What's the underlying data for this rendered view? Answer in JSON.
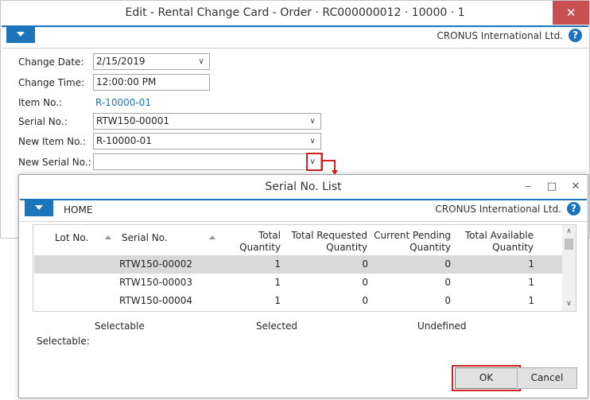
{
  "main_window": {
    "title": "Edit - Rental Change Card - Order · RC000000012 · 10000 · 1",
    "company": "CRONUS International Ltd.",
    "fields": {
      "change_date_label": "Change Date:",
      "change_date_value": "2/15/2019",
      "change_time_label": "Change Time:",
      "change_time_value": "12:00:00 PM",
      "item_no_label": "Item No.:",
      "item_no_value": "R-10000-01",
      "serial_no_label": "Serial No.:",
      "serial_no_value": "RTW150-00001",
      "new_item_no_label": "New Item No.:",
      "new_item_no_value": "R-10000-01",
      "new_serial_no_label": "New Serial No.:",
      "new_serial_no_value": ""
    }
  },
  "dialog": {
    "title": "Serial No. List",
    "ribbon_tab": "HOME",
    "company": "CRONUS International Ltd.",
    "columns": {
      "lot_no": "Lot No.",
      "serial_no": "Serial No.",
      "total_qty_1": "Total",
      "total_qty_2": "Quantity",
      "req_qty_1": "Total Requested",
      "req_qty_2": "Quantity",
      "pend_qty_1": "Current Pending",
      "pend_qty_2": "Quantity",
      "avail_qty_1": "Total Available",
      "avail_qty_2": "Quantity"
    },
    "rows": [
      {
        "lot_no": "",
        "serial_no": "RTW150-00002",
        "total": "1",
        "requested": "0",
        "pending": "0",
        "available": "1"
      },
      {
        "lot_no": "",
        "serial_no": "RTW150-00003",
        "total": "1",
        "requested": "0",
        "pending": "0",
        "available": "1"
      },
      {
        "lot_no": "",
        "serial_no": "RTW150-00004",
        "total": "1",
        "requested": "0",
        "pending": "0",
        "available": "1"
      }
    ],
    "legend": {
      "selectable": "Selectable",
      "selected": "Selected",
      "undefined": "Undefined"
    },
    "selectable_label": "Selectable:",
    "ok_label": "OK",
    "cancel_label": "Cancel"
  }
}
